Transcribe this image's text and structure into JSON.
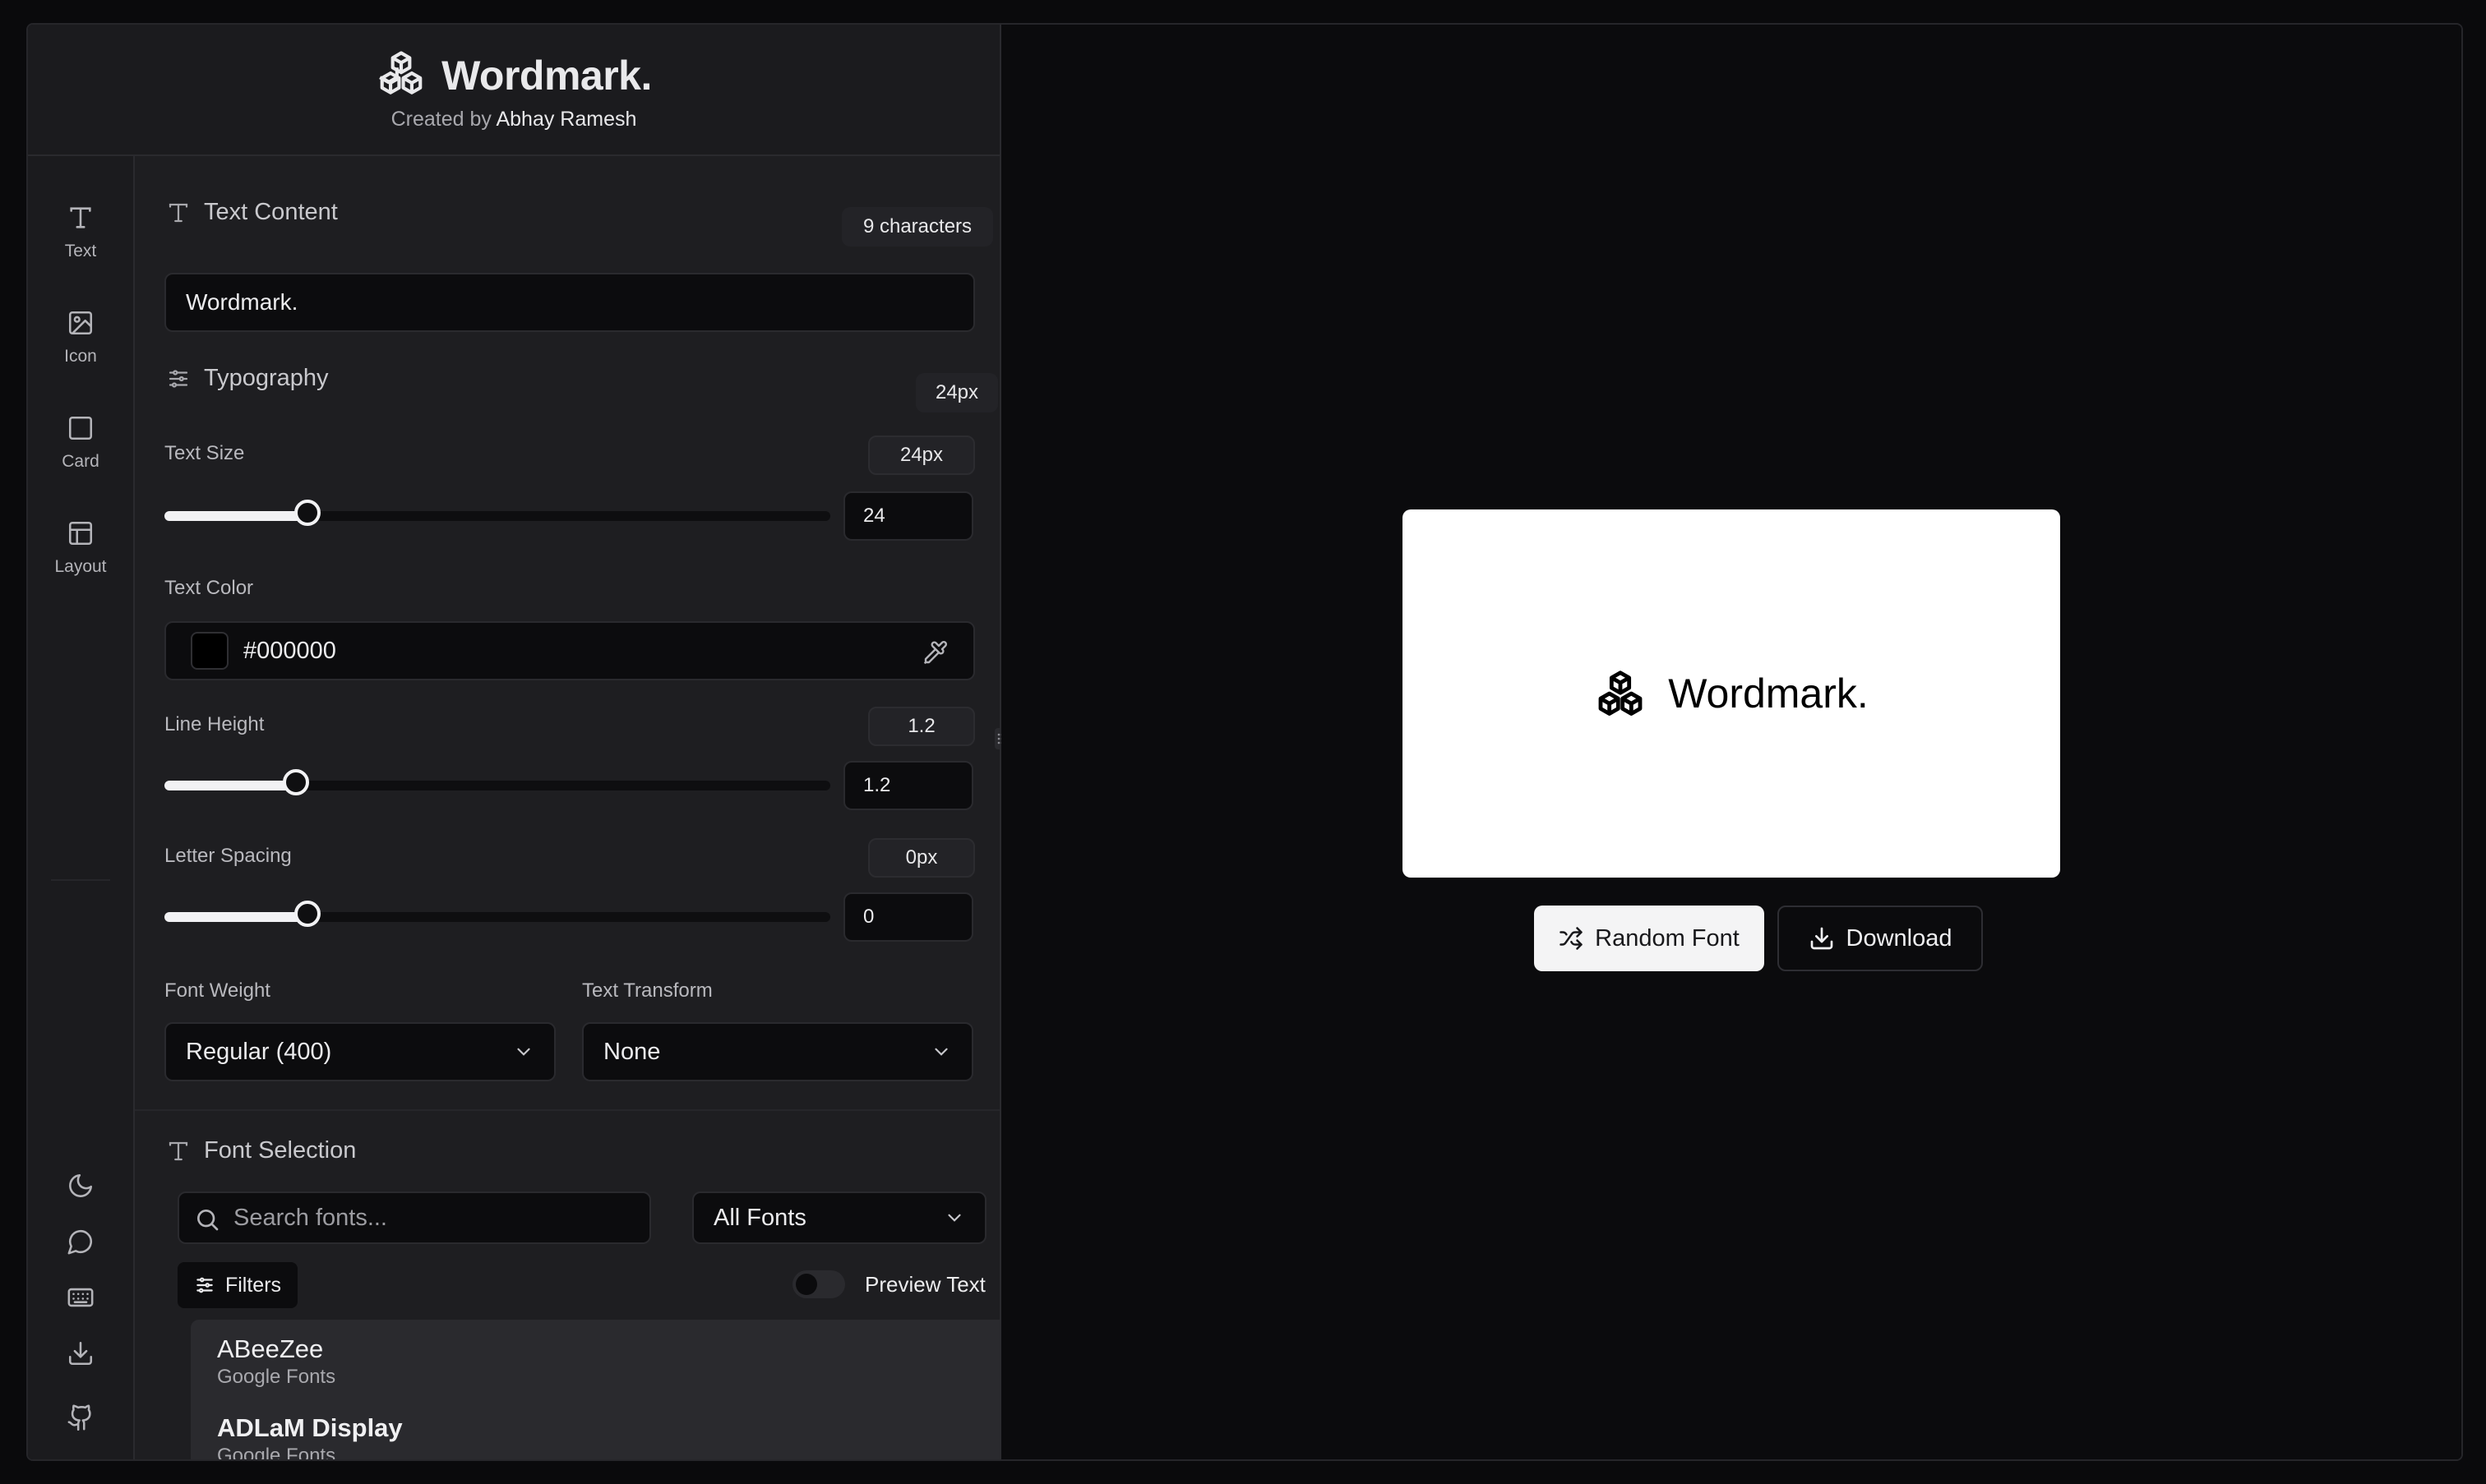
{
  "header": {
    "title": "Wordmark.",
    "created_by_prefix": "Created by",
    "author": "Abhay Ramesh"
  },
  "rail": {
    "items": [
      {
        "label": "Text",
        "icon": "text-icon"
      },
      {
        "label": "Icon",
        "icon": "image-icon"
      },
      {
        "label": "Card",
        "icon": "square-icon"
      },
      {
        "label": "Layout",
        "icon": "layout-icon"
      }
    ],
    "bottom_icons": [
      "moon-icon",
      "chat-icon",
      "keyboard-icon",
      "download-icon",
      "github-icon"
    ]
  },
  "text_content": {
    "title": "Text Content",
    "char_count": "9 characters",
    "value": "Wordmark."
  },
  "typography": {
    "title": "Typography",
    "badge": "24px",
    "text_size": {
      "label": "Text Size",
      "badge": "24px",
      "value": "24",
      "fraction": 0.215
    },
    "text_color": {
      "label": "Text Color",
      "value": "#000000",
      "swatch": "#000000"
    },
    "line_height": {
      "label": "Line Height",
      "badge": "1.2",
      "value": "1.2",
      "fraction": 0.197
    },
    "letter_spacing": {
      "label": "Letter Spacing",
      "badge": "0px",
      "value": "0",
      "fraction": 0.215
    },
    "font_weight": {
      "label": "Font Weight",
      "value": "Regular (400)"
    },
    "text_transform": {
      "label": "Text Transform",
      "value": "None"
    }
  },
  "font_selection": {
    "title": "Font Selection",
    "search_placeholder": "Search fonts...",
    "category": "All Fonts",
    "filters_label": "Filters",
    "preview_text_label": "Preview Text",
    "fonts": [
      {
        "name": "ABeeZee",
        "source": "Google Fonts"
      },
      {
        "name": "ADLaM Display",
        "source": "Google Fonts"
      }
    ]
  },
  "preview": {
    "text": "Wordmark.",
    "random_font_label": "Random Font",
    "download_label": "Download"
  }
}
